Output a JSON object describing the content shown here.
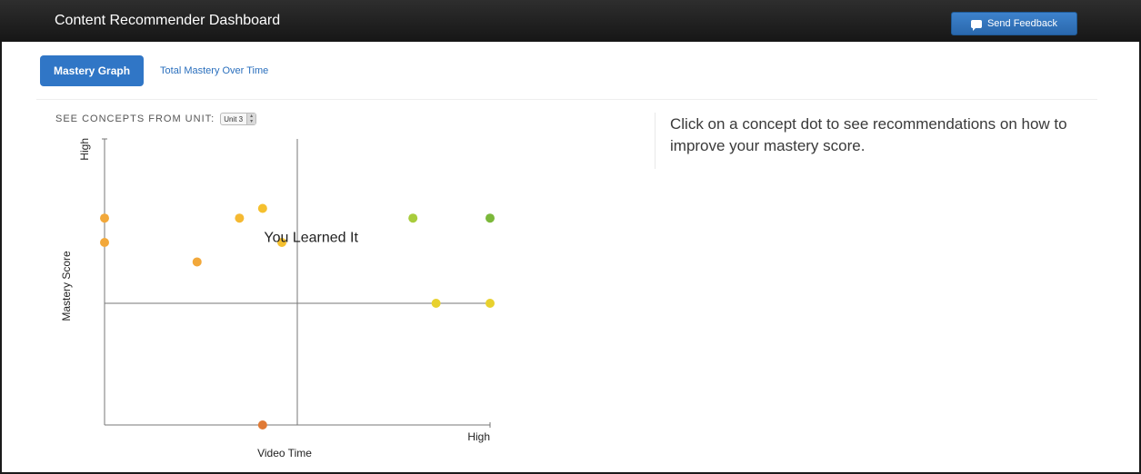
{
  "header": {
    "title": "Content Recommender Dashboard",
    "feedback_label": "Send Feedback",
    "feedback_icon": "chat-icon"
  },
  "tabs": [
    {
      "label": "Mastery Graph",
      "active": true
    },
    {
      "label": "Total Mastery Over Time",
      "active": false
    }
  ],
  "unit_selector": {
    "label": "SEE CONCEPTS FROM UNIT:",
    "selected": "Unit 3"
  },
  "hint_text": "Click on a concept dot to see recommendations on how to improve your mastery score.",
  "chart_data": {
    "type": "scatter",
    "xlabel": "Video Time",
    "ylabel": "Mastery Score",
    "x_high_label": "High",
    "y_high_label": "High",
    "xlim": [
      0,
      1
    ],
    "ylim": [
      0,
      1
    ],
    "quadrant_lines": {
      "x": 0.5,
      "y": 0.5
    },
    "annotation": {
      "text": "You Learned It",
      "x": 0.6,
      "y": 0.77
    },
    "points": [
      {
        "x": 0.0,
        "y": 0.85,
        "color": "#f2a83a"
      },
      {
        "x": 0.0,
        "y": 0.75,
        "color": "#f2a83a"
      },
      {
        "x": 0.24,
        "y": 0.67,
        "color": "#f2a83a"
      },
      {
        "x": 0.35,
        "y": 0.85,
        "color": "#f5b932"
      },
      {
        "x": 0.41,
        "y": 0.89,
        "color": "#f5c02e"
      },
      {
        "x": 0.46,
        "y": 0.75,
        "color": "#f5c02e"
      },
      {
        "x": 0.8,
        "y": 0.85,
        "color": "#a8cc3c"
      },
      {
        "x": 1.0,
        "y": 0.85,
        "color": "#7bb83a"
      },
      {
        "x": 0.86,
        "y": 0.5,
        "color": "#e8d12e"
      },
      {
        "x": 1.0,
        "y": 0.5,
        "color": "#e8d12e"
      },
      {
        "x": 0.41,
        "y": 0.0,
        "color": "#e07a35"
      }
    ]
  }
}
